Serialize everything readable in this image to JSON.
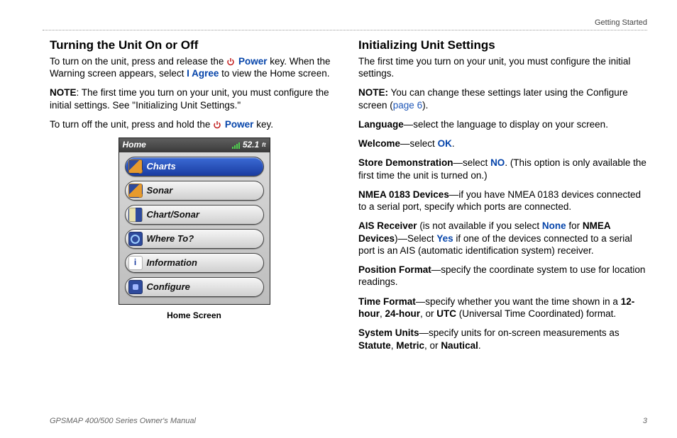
{
  "section_header": "Getting Started",
  "footer": {
    "manual": "GPSMAP 400/500 Series Owner's Manual",
    "page": "3"
  },
  "left": {
    "heading": "Turning the Unit On or Off",
    "p1_a": "To turn on the unit, press and release the ",
    "p1_power": "Power",
    "p1_b": " key. When the Warning screen appears, select ",
    "p1_agree": "I Agree",
    "p1_c": " to view the Home screen.",
    "note_label": "NOTE",
    "note_body": ": The first time you turn on your unit, you must configure the initial settings. See \"Initializing Unit Settings.\"",
    "p3_a": "To turn off the unit, press and hold the ",
    "p3_power": "Power",
    "p3_b": " key.",
    "caption": "Home Screen"
  },
  "device": {
    "title": "Home",
    "depth": "52.1",
    "unit_suffix": "ft",
    "items": [
      "Charts",
      "Sonar",
      "Chart/Sonar",
      "Where To?",
      "Information",
      "Configure"
    ]
  },
  "right": {
    "heading": "Initializing Unit Settings",
    "intro": "The first time you turn on your unit, you must configure the initial settings.",
    "note_label": "NOTE:",
    "note_body_a": " You can change these settings later using the Configure screen (",
    "note_link": "page 6",
    "note_body_b": ").",
    "lang_label": "Language",
    "lang_body": "—select the language to display on your screen.",
    "welcome_label": "Welcome",
    "welcome_sep": "—select ",
    "welcome_ok": "OK",
    "welcome_end": ".",
    "store_label": "Store Demonstration",
    "store_sep": "—select ",
    "store_no": "NO",
    "store_end": ". (This option is only available the first time the unit is turned on.)",
    "nmea_label": "NMEA 0183 Devices",
    "nmea_body": "—if you have NMEA 0183 devices connected to a serial port, specify which ports are connected.",
    "ais_label": "AIS Receiver",
    "ais_a": " (is not available if you select ",
    "ais_none": "None",
    "ais_b": " for ",
    "ais_nmea": "NMEA Devices",
    "ais_c": ")—Select ",
    "ais_yes": "Yes",
    "ais_d": " if one of the devices connected to a serial port is an AIS (automatic identification system) receiver.",
    "pos_label": "Position Format",
    "pos_body": "—specify the coordinate system to use for location readings.",
    "time_label": "Time Format",
    "time_a": "—specify whether you want the time shown in a ",
    "time_12": "12-hour",
    "time_sep1": ", ",
    "time_24": "24-hour",
    "time_sep2": ", or ",
    "time_utc": "UTC",
    "time_b": " (Universal Time Coordinated) format.",
    "sys_label": "System Units",
    "sys_a": "—specify units for on-screen measurements as ",
    "sys_stat": "Statute",
    "sys_sep1": ", ",
    "sys_met": "Metric",
    "sys_sep2": ", or ",
    "sys_naut": "Nautical",
    "sys_end": "."
  }
}
